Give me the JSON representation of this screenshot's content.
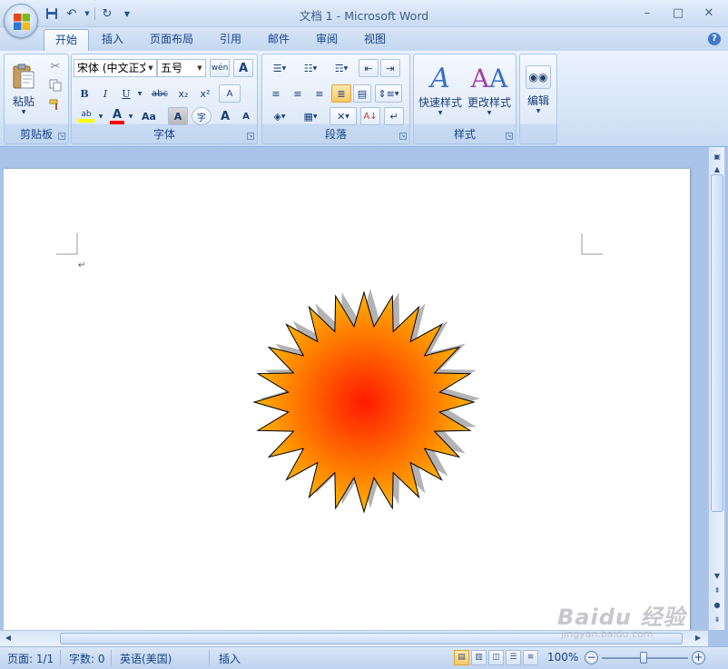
{
  "window": {
    "title": "文档 1 - Microsoft Word",
    "minimize": "–",
    "maximize": "□",
    "close": "✕"
  },
  "qat": {
    "save_icon": "save-icon",
    "undo_icon": "undo-icon",
    "redo_icon": "redo-icon",
    "customize_icon": "chevron-down-icon"
  },
  "tabs": [
    {
      "label": "开始",
      "active": true
    },
    {
      "label": "插入"
    },
    {
      "label": "页面布局"
    },
    {
      "label": "引用"
    },
    {
      "label": "邮件"
    },
    {
      "label": "审阅"
    },
    {
      "label": "视图"
    }
  ],
  "help_label": "?",
  "ribbon": {
    "clipboard": {
      "label": "剪贴板",
      "paste_label": "粘贴"
    },
    "font": {
      "label": "字体",
      "font_name": "宋体 (中文正文",
      "font_size": "五号",
      "bold": "B",
      "italic": "I",
      "underline": "U",
      "strike": "abc",
      "subscript": "x₂",
      "superscript": "x²",
      "clear_format": "A",
      "phonetic": "wén",
      "border_char": "A",
      "change_case": "Aa",
      "char_shading": "A",
      "enclose": "字",
      "grow": "A",
      "shrink": "A",
      "highlight": "ab",
      "font_color": "A"
    },
    "paragraph": {
      "label": "段落"
    },
    "styles": {
      "label": "样式",
      "quick_styles": "快速样式",
      "change_styles": "更改样式"
    },
    "editing": {
      "label": "编辑"
    }
  },
  "document": {
    "para_mark": "↵",
    "shape": {
      "type": "24-point star",
      "fill_center": "#ff1a00",
      "fill_edge": "#ffb300",
      "shadow": "#b3b3b3"
    }
  },
  "status": {
    "page": "页面: 1/1",
    "words": "字数: 0",
    "language": "英语(美国)",
    "insert_mode": "插入",
    "zoom": "100%",
    "zoom_level_percent": 100
  },
  "watermark": {
    "brand": "Baidu 经验",
    "url": "jingyan.baidu.com"
  }
}
